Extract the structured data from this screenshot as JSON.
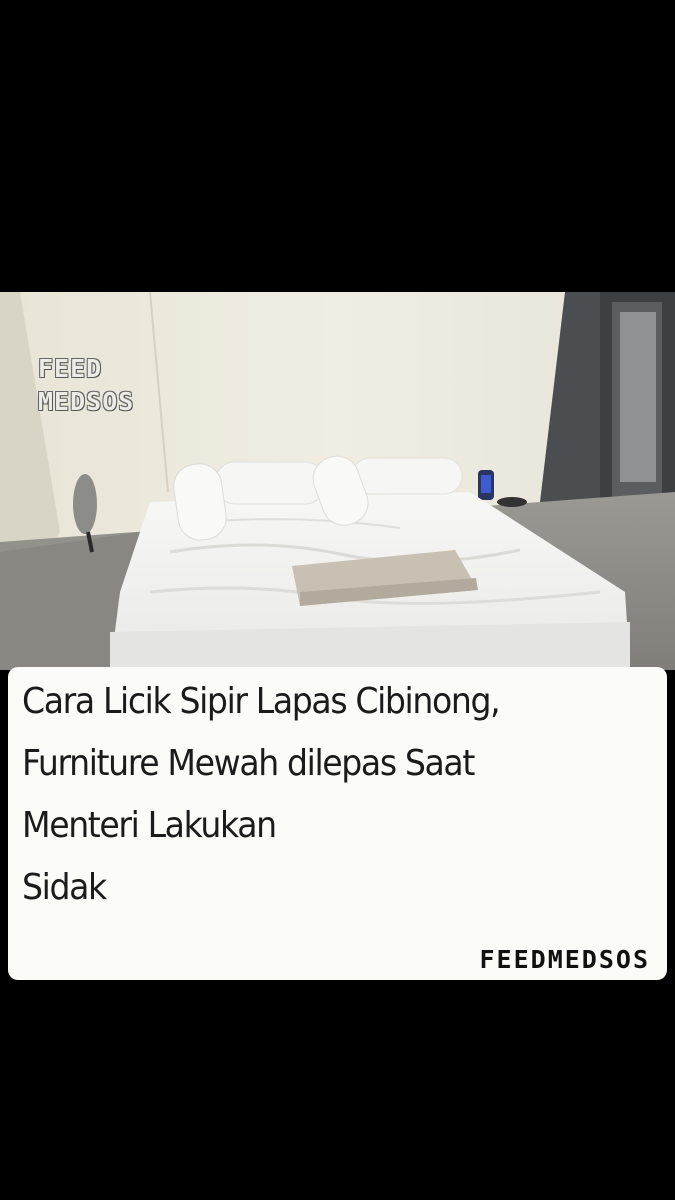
{
  "photo": {
    "watermark": [
      "FEED",
      "MEDSOS"
    ]
  },
  "caption": {
    "lines": [
      "Cara Licik Sipir Lapas Cibinong,",
      "Furniture Mewah dilepas Saat",
      "Menteri Lakukan",
      "Sidak"
    ],
    "brand": "FEEDMEDSOS"
  }
}
